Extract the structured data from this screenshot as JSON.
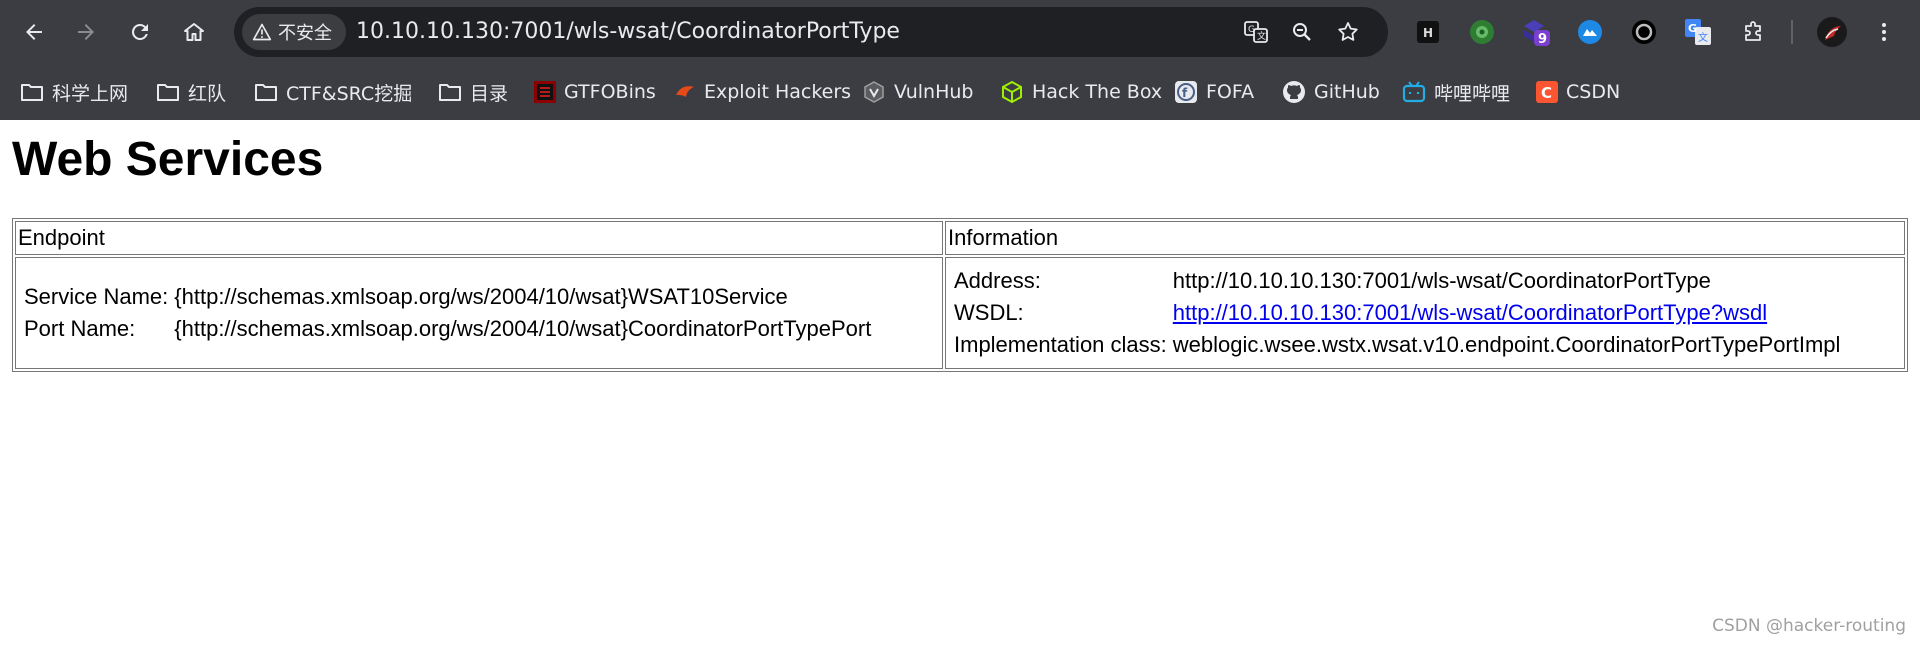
{
  "browser": {
    "security_label": "不安全",
    "url": "10.10.10.130:7001/wls-wsat/CoordinatorPortType",
    "extension_badge": "9",
    "bookmarks": [
      {
        "label": "科学上网",
        "icon": "folder-icon"
      },
      {
        "label": "红队",
        "icon": "folder-icon"
      },
      {
        "label": "CTF&SRC挖掘",
        "icon": "folder-icon"
      },
      {
        "label": "目录",
        "icon": "folder-icon"
      },
      {
        "label": "GTFOBins",
        "icon": "gtfobins-icon"
      },
      {
        "label": "Exploit Hackers",
        "icon": "exploit-hackers-icon"
      },
      {
        "label": "VulnHub",
        "icon": "vulnhub-icon"
      },
      {
        "label": "Hack The Box",
        "icon": "hackthebox-icon"
      },
      {
        "label": "FOFA",
        "icon": "fofa-icon"
      },
      {
        "label": "GitHub",
        "icon": "github-icon"
      },
      {
        "label": "哔哩哔哩",
        "icon": "bilibili-icon"
      },
      {
        "label": "CSDN",
        "icon": "csdn-icon"
      }
    ]
  },
  "page": {
    "title": "Web Services",
    "table": {
      "headers": [
        "Endpoint",
        "Information"
      ],
      "endpoint": {
        "service_name_label": "Service Name:",
        "service_name_value": "{http://schemas.xmlsoap.org/ws/2004/10/wsat}WSAT10Service",
        "port_name_label": "Port Name:",
        "port_name_value": "{http://schemas.xmlsoap.org/ws/2004/10/wsat}CoordinatorPortTypePort"
      },
      "information": {
        "address_label": "Address:",
        "address_value": "http://10.10.10.130:7001/wls-wsat/CoordinatorPortType",
        "wsdl_label": "WSDL:",
        "wsdl_value": "http://10.10.10.130:7001/wls-wsat/CoordinatorPortType?wsdl",
        "impl_label": "Implementation class:",
        "impl_value": "weblogic.wsee.wstx.wsat.v10.endpoint.CoordinatorPortTypePortImpl"
      }
    },
    "watermark": "CSDN @hacker-routing"
  },
  "colors": {
    "toolbar_bg": "#3b3d42",
    "omnibox_bg": "#1f2023",
    "link": "#0000ee"
  }
}
